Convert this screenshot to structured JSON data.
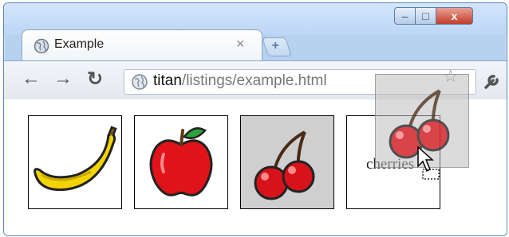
{
  "browser": {
    "tab_title": "Example",
    "tab_close_glyph": "×",
    "new_tab_glyph": "+",
    "window_controls": {
      "minimize": "–",
      "maximize": "□",
      "close": "x"
    },
    "url_host": "titan",
    "url_path": "/listings/example.html",
    "icons": [
      "globe-icon",
      "back-arrow-icon",
      "forward-arrow-icon",
      "reload-icon",
      "star-icon",
      "wrench-icon"
    ]
  },
  "page": {
    "tiles": [
      {
        "name": "banana",
        "image": "banana-icon",
        "highlighted": false,
        "label": ""
      },
      {
        "name": "apple",
        "image": "apple-icon",
        "highlighted": false,
        "label": ""
      },
      {
        "name": "cherries",
        "image": "cherries-icon",
        "highlighted": true,
        "label": ""
      },
      {
        "name": "drop-target",
        "image": "",
        "highlighted": false,
        "label": "cherries"
      }
    ]
  },
  "colors": {
    "window_frame": "#b6d2f0",
    "close_button": "#c33d2a",
    "tile_highlight": "#cfcfcf"
  }
}
